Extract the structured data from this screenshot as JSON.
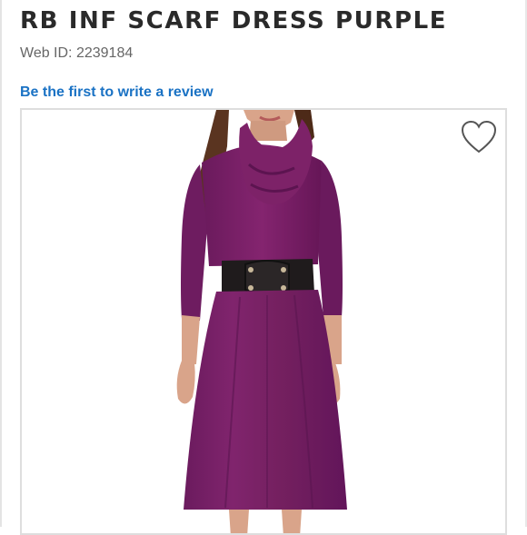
{
  "product": {
    "title": "RB INF SCARF DRESS PURPLE",
    "web_id": "Web ID: 2239184"
  },
  "reviews": {
    "link_text": "Be the first to write a review"
  },
  "colors": {
    "accent_link": "#1a72c4",
    "dress": "#7a2068",
    "text": "#2a2a2a"
  },
  "icons": {
    "favorite": "heart-outline-icon"
  }
}
